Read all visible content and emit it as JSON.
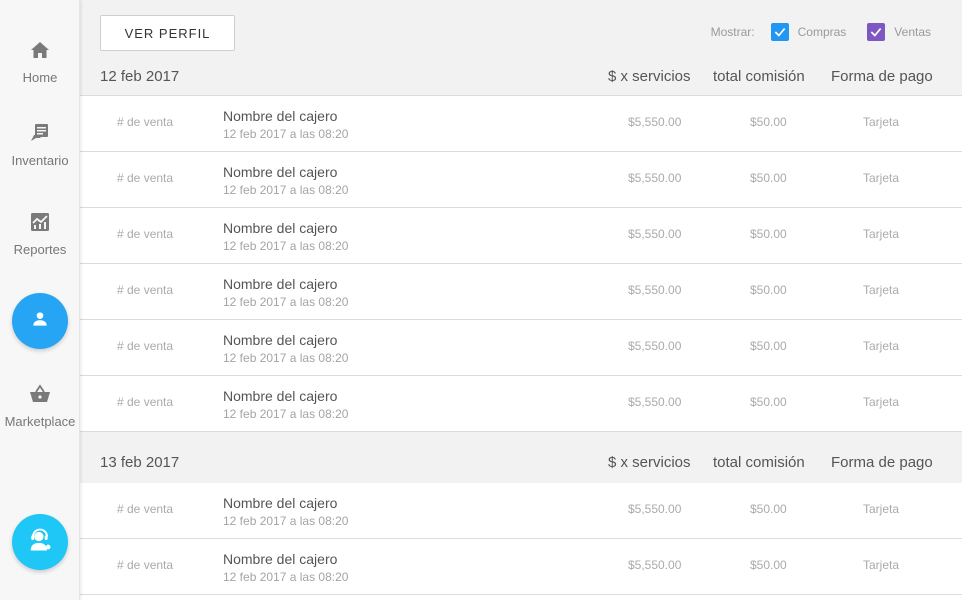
{
  "sidebar": {
    "items": [
      {
        "label": "Home",
        "icon": "home-icon"
      },
      {
        "label": "Inventario",
        "icon": "inventory-icon"
      },
      {
        "label": "Reportes",
        "icon": "reports-icon"
      },
      {
        "label": "",
        "icon": "person-icon"
      },
      {
        "label": "Marketplace",
        "icon": "basket-icon"
      },
      {
        "label": "",
        "icon": "support-agent-icon"
      }
    ]
  },
  "toolbar": {
    "profile_button": "VER PERFIL",
    "show_label": "Mostrar:",
    "compras_label": "Compras",
    "ventas_label": "Ventas",
    "compras_checked": true,
    "ventas_checked": true
  },
  "columns": {
    "servicios": "$ x servicios",
    "comision": "total comisión",
    "pago": "Forma de pago"
  },
  "groups": [
    {
      "date": "12 feb 2017",
      "rows": [
        {
          "num": "# de venta",
          "name": "Nombre del cajero",
          "time": "12 feb 2017 a las 08:20",
          "amount": "$5,550.00",
          "commission": "$50.00",
          "payment": "Tarjeta"
        },
        {
          "num": "# de venta",
          "name": "Nombre del cajero",
          "time": "12 feb 2017 a las 08:20",
          "amount": "$5,550.00",
          "commission": "$50.00",
          "payment": "Tarjeta"
        },
        {
          "num": "# de venta",
          "name": "Nombre del cajero",
          "time": "12 feb 2017 a las 08:20",
          "amount": "$5,550.00",
          "commission": "$50.00",
          "payment": "Tarjeta"
        },
        {
          "num": "# de venta",
          "name": "Nombre del cajero",
          "time": "12 feb 2017 a las 08:20",
          "amount": "$5,550.00",
          "commission": "$50.00",
          "payment": "Tarjeta"
        },
        {
          "num": "# de venta",
          "name": "Nombre del cajero",
          "time": "12 feb 2017 a las 08:20",
          "amount": "$5,550.00",
          "commission": "$50.00",
          "payment": "Tarjeta"
        },
        {
          "num": "# de venta",
          "name": "Nombre del cajero",
          "time": "12 feb 2017 a las 08:20",
          "amount": "$5,550.00",
          "commission": "$50.00",
          "payment": "Tarjeta"
        }
      ]
    },
    {
      "date": "13 feb 2017",
      "rows": [
        {
          "num": "# de venta",
          "name": "Nombre del cajero",
          "time": "12 feb 2017 a las 08:20",
          "amount": "$5,550.00",
          "commission": "$50.00",
          "payment": "Tarjeta"
        },
        {
          "num": "# de venta",
          "name": "Nombre del cajero",
          "time": "12 feb 2017 a las 08:20",
          "amount": "$5,550.00",
          "commission": "$50.00",
          "payment": "Tarjeta"
        }
      ]
    }
  ],
  "colors": {
    "accent_blue": "#2196f3",
    "profile_circle": "#27a5f5",
    "support_circle": "#1ec7f5",
    "ventas_purple": "#7e57c2",
    "compras_blue": "#2196f3"
  }
}
